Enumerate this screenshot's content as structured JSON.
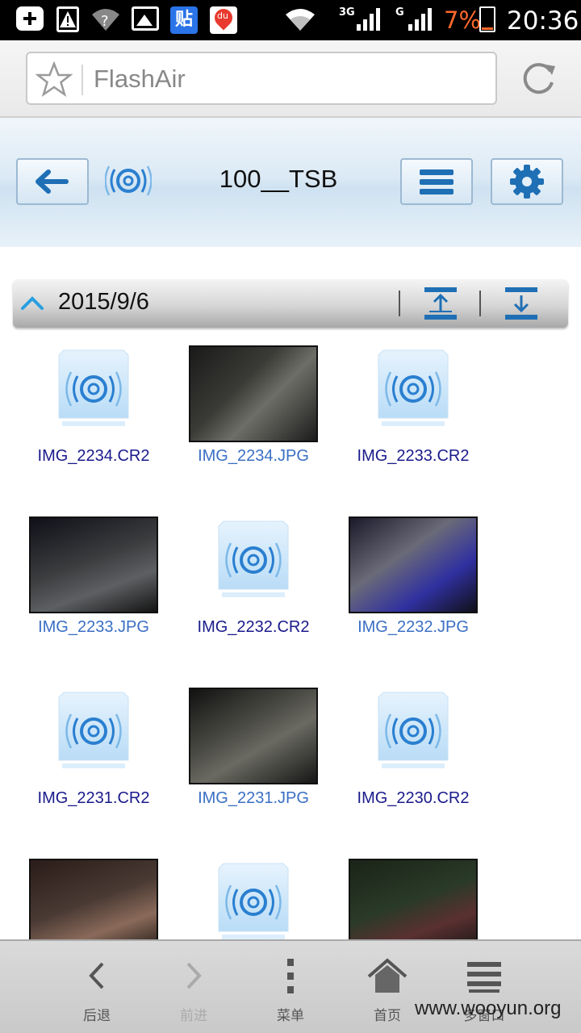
{
  "status_bar": {
    "tieba_glyph": "贴",
    "du_label": "du",
    "network_3g": "3G",
    "network_g": "G",
    "battery_percent": "7%",
    "time": "20:36",
    "icons": [
      "add-icon",
      "warning-icon",
      "wifi-unknown-icon",
      "image-icon",
      "tieba-icon",
      "baidu-map-icon",
      "wifi-icon",
      "signal-icon",
      "battery-icon"
    ]
  },
  "browser": {
    "url_text": "FlashAir",
    "icons": [
      "star-icon",
      "reload-icon"
    ]
  },
  "flashair": {
    "folder_name": "100__TSB",
    "icons": [
      "back-arrow-icon",
      "flashair-logo-icon",
      "menu-icon",
      "gear-icon"
    ]
  },
  "date_group": {
    "date": "2015/9/6",
    "icons": [
      "collapse-caret-icon",
      "scroll-top-icon",
      "scroll-bottom-icon"
    ]
  },
  "files": [
    {
      "name": "IMG_2234.CR2",
      "kind": "raw"
    },
    {
      "name": "IMG_2234.JPG",
      "kind": "jpg"
    },
    {
      "name": "IMG_2233.CR2",
      "kind": "raw"
    },
    {
      "name": "IMG_2233.JPG",
      "kind": "jpg"
    },
    {
      "name": "IMG_2232.CR2",
      "kind": "raw"
    },
    {
      "name": "IMG_2232.JPG",
      "kind": "jpg"
    },
    {
      "name": "IMG_2231.CR2",
      "kind": "raw"
    },
    {
      "name": "IMG_2231.JPG",
      "kind": "jpg"
    },
    {
      "name": "IMG_2230.CR2",
      "kind": "raw"
    },
    {
      "name": "",
      "kind": "jpg"
    },
    {
      "name": "",
      "kind": "raw"
    },
    {
      "name": "",
      "kind": "jpg"
    }
  ],
  "bottom_nav": [
    {
      "label": "后退",
      "icon": "back-chevron-icon",
      "enabled": true
    },
    {
      "label": "前进",
      "icon": "forward-chevron-icon",
      "enabled": false
    },
    {
      "label": "菜单",
      "icon": "menu-dots-icon",
      "enabled": true
    },
    {
      "label": "首页",
      "icon": "home-icon",
      "enabled": true
    },
    {
      "label": "多窗口",
      "icon": "windows-icon",
      "enabled": true
    }
  ],
  "watermark": "www.wooyun.org",
  "colors": {
    "accent_blue": "#2a7fd0",
    "raw_caption": "#1a1a8c",
    "jpg_caption": "#3a6fc4",
    "battery_low": "#ff6a2a"
  }
}
